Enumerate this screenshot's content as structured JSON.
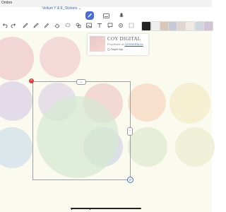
{
  "status": {
    "time": "Ombro"
  },
  "document": {
    "title": "Vellum Y & E_Stickers ⌄"
  },
  "toolbar": {
    "tools": [
      "pen-tool-icon",
      "eraser-icon",
      "lasso-icon",
      "shapes-icon",
      "text-icon",
      "image-icon",
      "comment-icon"
    ]
  },
  "popup": {
    "name": "COY DIGITAL",
    "owner_prefix": "Proprietário de ",
    "owner_link": "COYDIGITALCo",
    "follow_label": "Seguir loja"
  },
  "selection": {
    "close_symbol": "×",
    "top_handle_symbol": "⌄",
    "right_handle_symbol": "⌃",
    "rotate_symbol": "⟳"
  },
  "colors": {
    "accent": "#4a6bdc",
    "page_background": "#fbfaef"
  }
}
